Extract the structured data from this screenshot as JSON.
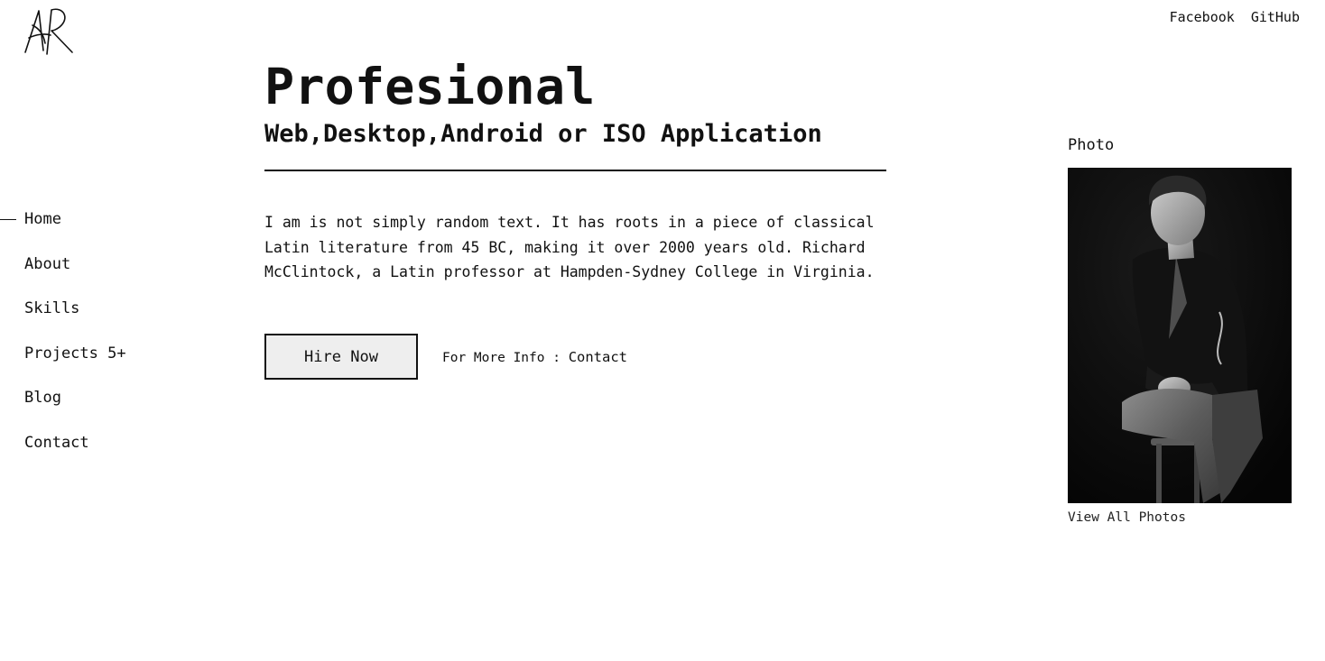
{
  "header": {
    "logo_icon": "signature-logo-icon",
    "links": [
      {
        "label": "Facebook"
      },
      {
        "label": "GitHub"
      }
    ]
  },
  "nav": {
    "items": [
      {
        "label": "Home",
        "active": true
      },
      {
        "label": "About",
        "active": false
      },
      {
        "label": "Skills",
        "active": false
      },
      {
        "label": "Projects 5+",
        "active": false
      },
      {
        "label": "Blog",
        "active": false
      },
      {
        "label": "Contact",
        "active": false
      }
    ]
  },
  "hero": {
    "title": "Profesional",
    "subtitle": "Web,Desktop,Android or ISO Application",
    "description": "I am is not simply random text. It has roots in a piece of classical Latin literature from 45 BC, making it over 2000 years old. Richard McClintock, a Latin professor at Hampden-Sydney College in Virginia.",
    "hire_button": "Hire Now",
    "more_info_prefix": "For More Info :",
    "more_info_link": "Contact"
  },
  "photo": {
    "label": "Photo",
    "view_all": "View All Photos",
    "image_icon": "portrait-photo"
  },
  "colors": {
    "text": "#111111",
    "button_bg": "#eeeeee",
    "background": "#ffffff"
  }
}
